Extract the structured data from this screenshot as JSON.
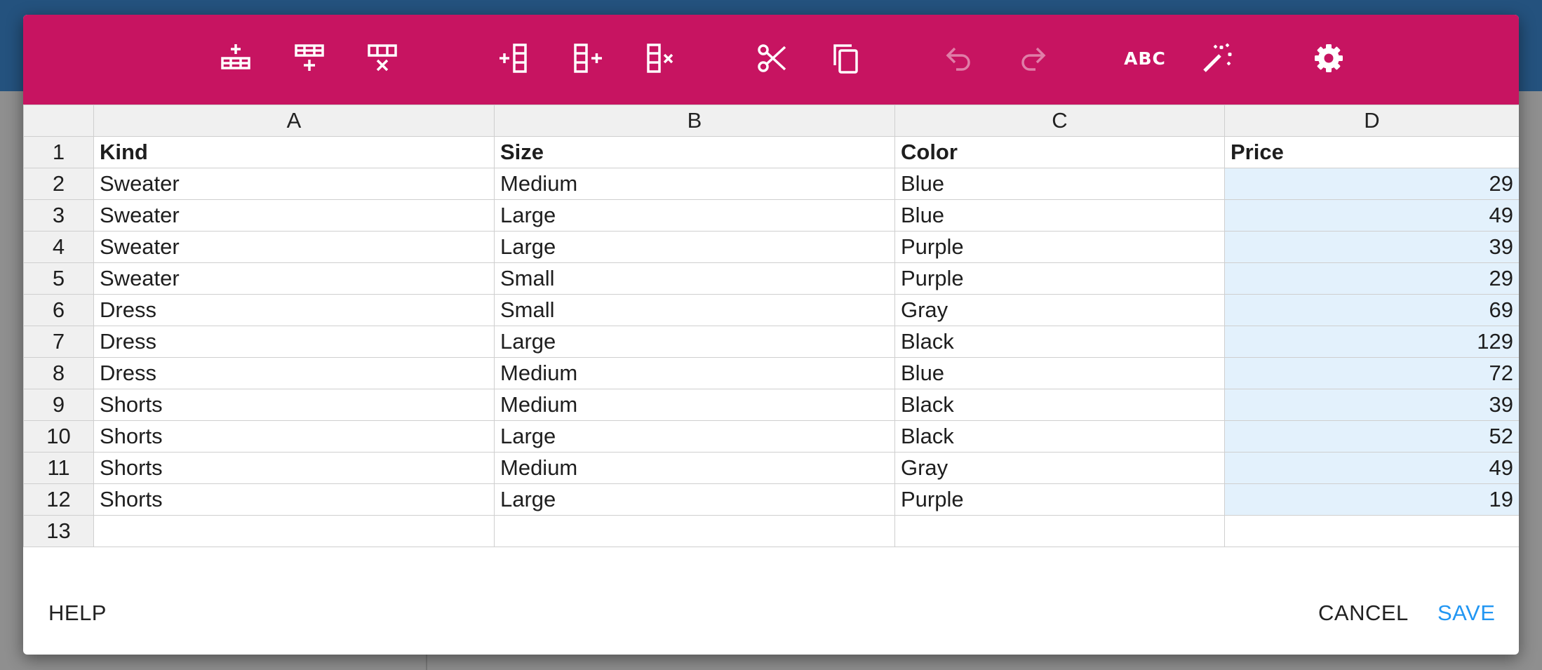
{
  "toolbar": {
    "buttons": [
      {
        "icon": "insert-row-above-icon"
      },
      {
        "icon": "insert-row-below-icon"
      },
      {
        "icon": "delete-row-icon"
      },
      {
        "icon": "insert-column-left-icon"
      },
      {
        "icon": "insert-column-right-icon"
      },
      {
        "icon": "delete-column-icon"
      },
      {
        "icon": "cut-icon"
      },
      {
        "icon": "copy-icon"
      },
      {
        "icon": "undo-icon",
        "disabled": true
      },
      {
        "icon": "redo-icon",
        "disabled": true
      },
      {
        "icon": "spellcheck-icon",
        "label": "ABC"
      },
      {
        "icon": "magic-wand-icon"
      },
      {
        "icon": "settings-gear-icon"
      }
    ],
    "color": "#c71461"
  },
  "sheet": {
    "columns": [
      "A",
      "B",
      "C",
      "D"
    ],
    "rows": [
      {
        "n": "1",
        "cells": [
          "Kind",
          "Size",
          "Color",
          "Price"
        ]
      },
      {
        "n": "2",
        "cells": [
          "Sweater",
          "Medium",
          "Blue",
          "29"
        ]
      },
      {
        "n": "3",
        "cells": [
          "Sweater",
          "Large",
          "Blue",
          "49"
        ]
      },
      {
        "n": "4",
        "cells": [
          "Sweater",
          "Large",
          "Purple",
          "39"
        ]
      },
      {
        "n": "5",
        "cells": [
          "Sweater",
          "Small",
          "Purple",
          "29"
        ]
      },
      {
        "n": "6",
        "cells": [
          "Dress",
          "Small",
          "Gray",
          "69"
        ]
      },
      {
        "n": "7",
        "cells": [
          "Dress",
          "Large",
          "Black",
          "129"
        ]
      },
      {
        "n": "8",
        "cells": [
          "Dress",
          "Medium",
          "Blue",
          "72"
        ]
      },
      {
        "n": "9",
        "cells": [
          "Shorts",
          "Medium",
          "Black",
          "39"
        ]
      },
      {
        "n": "10",
        "cells": [
          "Shorts",
          "Large",
          "Black",
          "52"
        ]
      },
      {
        "n": "11",
        "cells": [
          "Shorts",
          "Medium",
          "Gray",
          "49"
        ]
      },
      {
        "n": "12",
        "cells": [
          "Shorts",
          "Large",
          "Purple",
          "19"
        ]
      },
      {
        "n": "13",
        "cells": [
          "",
          "",
          "",
          ""
        ]
      }
    ],
    "numeric_highlight_color": "#e3f1fc"
  },
  "footer": {
    "help_label": "HELP",
    "cancel_label": "CANCEL",
    "save_label": "SAVE",
    "save_color": "#2196f3"
  }
}
